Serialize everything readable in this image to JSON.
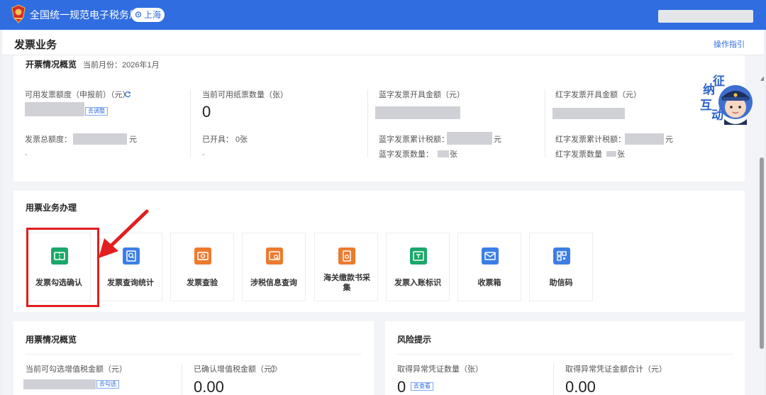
{
  "header": {
    "site_title": "全国统一规范电子税务局",
    "region": "上海"
  },
  "page": {
    "title": "发票业务",
    "guide_link": "操作指引"
  },
  "overview": {
    "title": "开票情况概览",
    "month_label": "当前月份：2026年1月",
    "col1": {
      "label": "可用发票额度（申报前）（元）",
      "adjust_btn": "去调整",
      "total_label": "发票总额度：",
      "total_unit": "元",
      "dash": "-"
    },
    "col2": {
      "label": "当前可用纸票数量（张）",
      "value": "0",
      "issued_label": "已开具：",
      "issued_value": "0张",
      "dash": "-"
    },
    "col3": {
      "label": "蓝字发票开具金额（元）",
      "tax_label": "蓝字发票累计税额：",
      "tax_unit": "元",
      "count_label": "蓝字发票数量：",
      "count_unit": "张"
    },
    "col4": {
      "label": "红字发票开具金额（元）",
      "tax_label": "红字发票累计税额：",
      "tax_unit": "元",
      "count_label": "红字发票数量",
      "count_unit": "张"
    }
  },
  "business": {
    "title": "用票业务办理",
    "tiles": [
      {
        "label": "发票勾选确认",
        "icon": "ticket-icon",
        "color": "#1aa86a"
      },
      {
        "label": "发票查询统计",
        "icon": "search-doc-icon",
        "color": "#3d7ee6"
      },
      {
        "label": "发票查验",
        "icon": "ticket-check-icon",
        "color": "#ee7a2e"
      },
      {
        "label": "涉税信息查询",
        "icon": "doc-search-icon",
        "color": "#ee7a2e"
      },
      {
        "label": "海关缴款书采集",
        "icon": "customs-doc-icon",
        "color": "#ee7a2e"
      },
      {
        "label": "发票入账标识",
        "icon": "invoice-mark-icon",
        "color": "#1aa86a"
      },
      {
        "label": "收票箱",
        "icon": "mail-icon",
        "color": "#3d7ee6"
      },
      {
        "label": "助信码",
        "icon": "qr-code-icon",
        "color": "#3d7ee6"
      }
    ]
  },
  "usage": {
    "title": "用票情况概览",
    "vat_label": "当前可勾选增值税金额（元）",
    "check_btn": "去勾选",
    "confirmed_label": "已确认增值税金额（元）",
    "confirmed_value": "0.00"
  },
  "risk": {
    "title": "风险提示",
    "abn_count_label": "取得异常凭证数量（张）",
    "abn_count_value": "0",
    "view_btn": "去查看",
    "abn_amount_label": "取得异常凭证金额合计（元）",
    "abn_amount_value": "0.00"
  },
  "mascot": {
    "chars": [
      "征",
      "纳",
      "互",
      "动"
    ]
  },
  "colors": {
    "brand": "#2f6de1",
    "highlight": "#e21e1e"
  }
}
